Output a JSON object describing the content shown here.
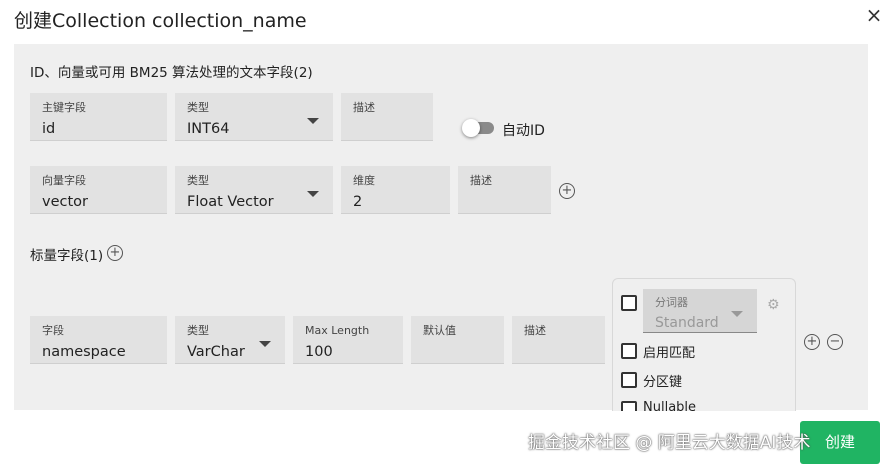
{
  "dialog": {
    "title": "创建Collection collection_name",
    "close_icon": "×"
  },
  "id_section": {
    "title": "ID、向量或可用 BM25 算法处理的文本字段(2)",
    "primary_key": {
      "label": "主键字段",
      "value": "id"
    },
    "type": {
      "label": "类型",
      "value": "INT64"
    },
    "description": {
      "label": "描述",
      "value": ""
    },
    "auto_id": {
      "label": "自动ID",
      "enabled": false
    }
  },
  "vector_section": {
    "vector_field": {
      "label": "向量字段",
      "value": "vector"
    },
    "type": {
      "label": "类型",
      "value": "Float Vector"
    },
    "dimension": {
      "label": "维度",
      "value": "2"
    },
    "description": {
      "label": "描述",
      "value": ""
    },
    "add_icon": "+"
  },
  "scalar_section": {
    "title": "标量字段(1)",
    "add_icon": "+",
    "field": {
      "label": "字段",
      "value": "namespace"
    },
    "type": {
      "label": "类型",
      "value": "VarChar"
    },
    "max_length": {
      "label": "Max Length",
      "value": "100"
    },
    "default_value": {
      "label": "默认值",
      "value": ""
    },
    "description": {
      "label": "描述",
      "value": ""
    },
    "tokenizer": {
      "label": "分词器",
      "value": "Standard"
    },
    "enable_match": "启用匹配",
    "partition_key": "分区键",
    "nullable": "Nullable",
    "add_icon_row": "+",
    "remove_icon_row": "−"
  },
  "footer": {
    "create_button": "创建",
    "watermark": "掘金技术社区 @ 阿里云大数据AI技术"
  }
}
